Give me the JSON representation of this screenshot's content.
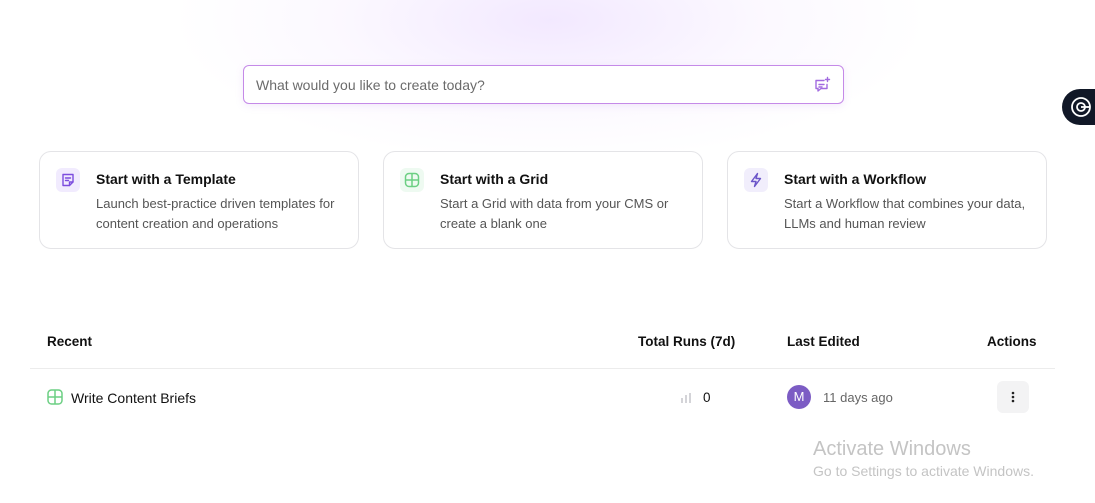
{
  "search": {
    "placeholder": "What would you like to create today?",
    "icon": "chat-sparkle-icon"
  },
  "cards": [
    {
      "title": "Start with a Template",
      "description": "Launch best-practice driven templates for content creation and operations",
      "icon": "template-doc-icon",
      "accent": "#8b5cf6"
    },
    {
      "title": "Start with a Grid",
      "description": "Start a Grid with data from your CMS or create a blank one",
      "icon": "grid-icon",
      "accent": "#6ccf83"
    },
    {
      "title": "Start with a Workflow",
      "description": "Start a Workflow that combines your data, LLMs and human review",
      "icon": "lightning-icon",
      "accent": "#7c6ad6"
    }
  ],
  "table": {
    "headers": {
      "recent": "Recent",
      "total_runs": "Total Runs (7d)",
      "last_edited": "Last Edited",
      "actions": "Actions"
    },
    "rows": [
      {
        "name": "Write Content Briefs",
        "type_icon": "grid-icon",
        "runs": "0",
        "avatar_initial": "M",
        "last_edited": "11 days ago"
      }
    ]
  },
  "watermark": {
    "title": "Activate Windows",
    "subtitle": "Go to Settings to activate Windows."
  },
  "colors": {
    "search_border": "#c58ae8",
    "avatar": "#7c5cc4",
    "grid_green": "#6ccf83",
    "fab_bg": "#111827"
  }
}
